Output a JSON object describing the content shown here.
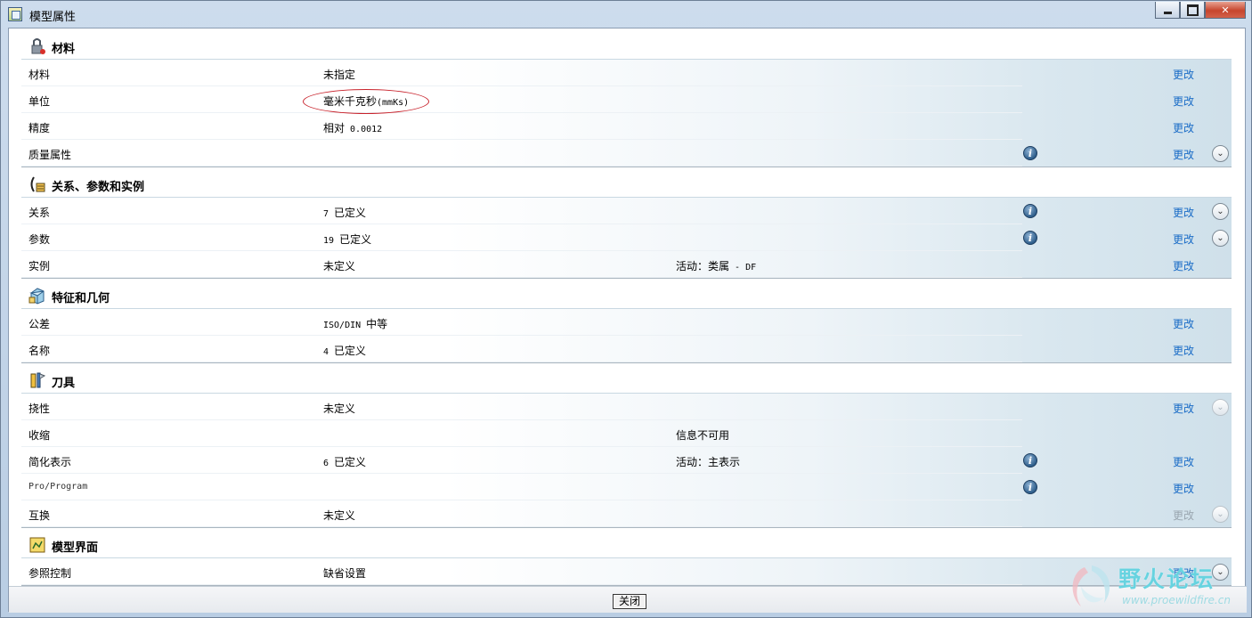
{
  "window": {
    "title": "模型属性"
  },
  "sections": [
    {
      "title": "材料",
      "icon": "material-icon",
      "rows": [
        {
          "label": "材料",
          "value": "未指定",
          "extra": "",
          "info": false,
          "edit": "更改",
          "edit_enabled": true,
          "expand": false
        },
        {
          "label": "单位",
          "value": "毫米千克秒",
          "value_mono": "(mmKs)",
          "extra": "",
          "info": false,
          "edit": "更改",
          "edit_enabled": true,
          "expand": false
        },
        {
          "label": "精度",
          "value": "相对",
          "value_mono": " 0.0012",
          "extra": "",
          "info": false,
          "edit": "更改",
          "edit_enabled": true,
          "expand": false
        },
        {
          "label": "质量属性",
          "value": "",
          "extra": "",
          "info": true,
          "edit": "更改",
          "edit_enabled": true,
          "expand": true
        }
      ]
    },
    {
      "title": "关系、参数和实例",
      "icon": "relations-icon",
      "rows": [
        {
          "label": "关系",
          "value_mono": "7 ",
          "value": "已定义",
          "extra": "",
          "info": true,
          "edit": "更改",
          "edit_enabled": true,
          "expand": true
        },
        {
          "label": "参数",
          "value_mono": "19 ",
          "value": "已定义",
          "extra": "",
          "info": true,
          "edit": "更改",
          "edit_enabled": true,
          "expand": true
        },
        {
          "label": "实例",
          "value": "未定义",
          "extra": "活动：类属",
          "extra_mono": " - DF",
          "info": false,
          "edit": "更改",
          "edit_enabled": true,
          "expand": false
        }
      ]
    },
    {
      "title": "特征和几何",
      "icon": "features-icon",
      "rows": [
        {
          "label": "公差",
          "value_mono": "ISO/DIN ",
          "value": "中等",
          "extra": "",
          "info": false,
          "edit": "更改",
          "edit_enabled": true,
          "expand": false
        },
        {
          "label": "名称",
          "value_mono": "4 ",
          "value": "已定义",
          "extra": "",
          "info": false,
          "edit": "更改",
          "edit_enabled": true,
          "expand": false
        }
      ]
    },
    {
      "title": "刀具",
      "icon": "tools-icon",
      "rows": [
        {
          "label": "挠性",
          "value": "未定义",
          "extra": "",
          "info": false,
          "edit": "更改",
          "edit_enabled": true,
          "expand": true,
          "expand_disabled": true
        },
        {
          "label": "收缩",
          "value": "",
          "extra": "信息不可用",
          "info": false,
          "edit": "",
          "edit_enabled": false,
          "expand": false
        },
        {
          "label": "简化表示",
          "value_mono": "6 ",
          "value": "已定义",
          "extra": "活动：主表示",
          "info": true,
          "edit": "更改",
          "edit_enabled": true,
          "expand": false
        },
        {
          "label": "Pro/Program",
          "label_mono": true,
          "value": "",
          "extra": "",
          "info": true,
          "edit": "更改",
          "edit_enabled": true,
          "expand": false
        },
        {
          "label": "互换",
          "value": "未定义",
          "extra": "",
          "info": false,
          "edit": "更改",
          "edit_enabled": false,
          "expand": true,
          "expand_disabled": true
        }
      ]
    },
    {
      "title": "模型界面",
      "icon": "model-interface-icon",
      "rows": [
        {
          "label": "参照控制",
          "value": "缺省设置",
          "extra": "",
          "info": false,
          "edit": "更改",
          "edit_enabled": true,
          "expand": true
        }
      ]
    }
  ],
  "footer": {
    "close_label": "关闭"
  },
  "watermark": {
    "text": "野火论坛",
    "url": "www.proewildfire.cn"
  },
  "icons": {
    "info": "info-icon",
    "expand": "chevron-down-icon"
  },
  "colors": {
    "link": "#1a6cc7",
    "highlight_ellipse": "#c8232c"
  }
}
